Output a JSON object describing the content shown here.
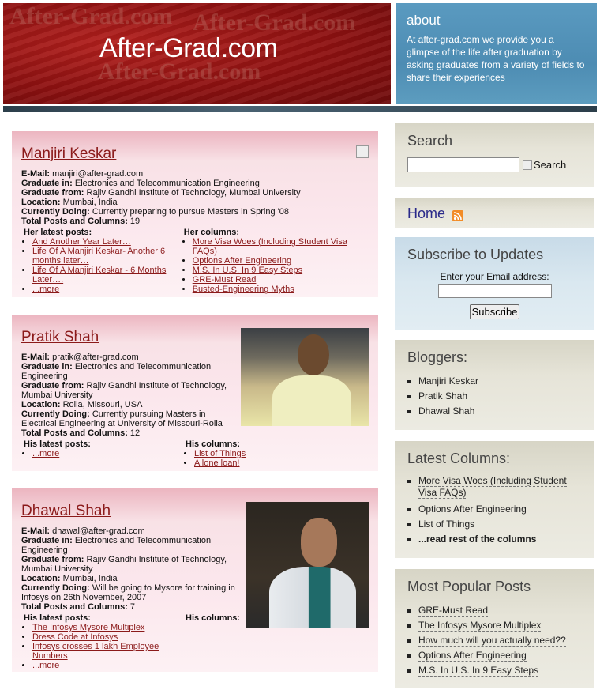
{
  "header": {
    "site_title": "After-Grad.com",
    "watermark": "After-Grad.com",
    "about_title": "about",
    "about_text": "At after-grad.com we provide you a glimpse of the life after graduation by asking graduates from a variety of fields to share their experiences"
  },
  "profiles": [
    {
      "name": "Manjiri Keskar",
      "email_label": "E-Mail:",
      "email": "manjiri@after-grad.com",
      "graduate_in_label": "Graduate in:",
      "graduate_in": "Electronics and Telecommunication Engineering",
      "graduate_from_label": "Graduate from:",
      "graduate_from": "Rajiv Gandhi Institute of Technology, Mumbai University",
      "location_label": "Location:",
      "location": "Mumbai, India",
      "doing_label": "Currently Doing:",
      "doing": "Currently preparing to pursue Masters in Spring '08",
      "total_label": "Total Posts and Columns:",
      "total": "19",
      "posts_heading": "Her latest posts:",
      "posts": [
        "And Another Year Later…",
        "Life Of A Manjiri Keskar- Another 6 months later…",
        "Life Of A Manjiri Keskar - 6 Months Later…."
      ],
      "more": "...more",
      "columns_heading": "Her columns:",
      "columns": [
        "More Visa Woes (Including Student Visa FAQs)",
        "Options After Engineering",
        "M.S. In U.S. In 9 Easy Steps",
        "GRE-Must Read",
        "Busted-Engineering Myths"
      ]
    },
    {
      "name": "Pratik Shah",
      "email_label": "E-Mail:",
      "email": "pratik@after-grad.com",
      "graduate_in_label": "Graduate in:",
      "graduate_in": "Electronics and Telecommunication Engineering",
      "graduate_from_label": "Graduate from:",
      "graduate_from": "Rajiv Gandhi Institute of Technology, Mumbai University",
      "location_label": "Location:",
      "location": "Rolla, Missouri, USA",
      "doing_label": "Currently Doing:",
      "doing": "Currently pursuing Masters in Electrical Engineering at University of Missouri-Rolla",
      "total_label": "Total Posts and Columns:",
      "total": "12",
      "posts_heading": "His latest posts:",
      "posts": [],
      "more": "...more",
      "columns_heading": "His columns:",
      "columns": [
        "List of Things",
        "A lone loan!"
      ]
    },
    {
      "name": "Dhawal Shah",
      "email_label": "E-Mail:",
      "email": "dhawal@after-grad.com",
      "graduate_in_label": "Graduate in:",
      "graduate_in": "Electronics and Telecommunication Engineering",
      "graduate_from_label": "Graduate from:",
      "graduate_from": "Rajiv Gandhi Institute of Technology, Mumbai University",
      "location_label": "Location:",
      "location": "Mumbai, India",
      "doing_label": "Currently Doing:",
      "doing": "Will be going to Mysore for training in Infosys on 26th November, 2007",
      "total_label": "Total Posts and Columns:",
      "total": "7",
      "posts_heading": "His latest posts:",
      "posts": [
        "The Infosys Mysore Multiplex",
        "Dress Code at Infosys",
        "Infosys crosses 1 lakh Employee Numbers"
      ],
      "more": "...more",
      "columns_heading": "His columns:",
      "columns": []
    }
  ],
  "sidebar": {
    "search": {
      "title": "Search",
      "button_alt": "Search"
    },
    "home": {
      "label": "Home"
    },
    "subscribe": {
      "title": "Subscribe to Updates",
      "prompt": "Enter your Email address:",
      "button": "Subscribe"
    },
    "bloggers": {
      "title": "Bloggers:",
      "items": [
        "Manjiri Keskar",
        "Pratik Shah",
        "Dhawal Shah"
      ]
    },
    "latest_columns": {
      "title": "Latest Columns:",
      "items": [
        "More Visa Woes (Including Student Visa FAQs)",
        "Options After Engineering",
        "List of Things"
      ],
      "read_rest": "...read rest of the columns"
    },
    "popular": {
      "title": "Most Popular Posts",
      "items": [
        "GRE-Must Read",
        "The Infosys Mysore Multiplex",
        "How much will you actually need??",
        "Options After Engineering",
        "M.S. In U.S. In 9 Easy Steps"
      ]
    }
  }
}
